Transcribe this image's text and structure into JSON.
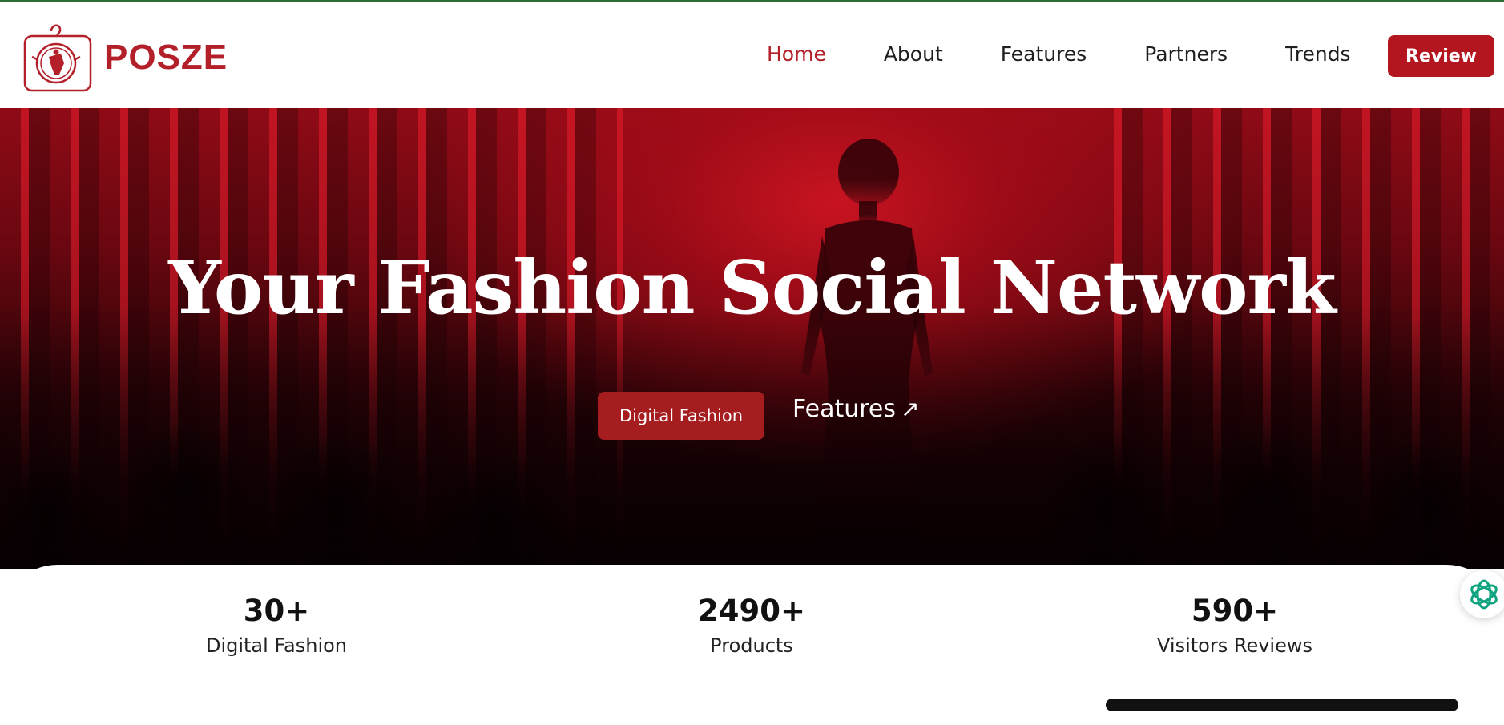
{
  "brand": {
    "name": "POSZE",
    "color": "#b3202a"
  },
  "nav": {
    "items": [
      {
        "label": "Home",
        "active": true
      },
      {
        "label": "About",
        "active": false
      },
      {
        "label": "Features",
        "active": false
      },
      {
        "label": "Partners",
        "active": false
      },
      {
        "label": "Trends",
        "active": false
      }
    ],
    "review_label": "Review"
  },
  "hero": {
    "title": "Your Fashion Social Network",
    "primary_cta": "Digital Fashion",
    "secondary_cta": "Features",
    "secondary_cta_icon": "arrow-up-right-icon"
  },
  "stats": [
    {
      "value": "30+",
      "label": "Digital Fashion"
    },
    {
      "value": "2490+",
      "label": "Products"
    },
    {
      "value": "590+",
      "label": "Visitors Reviews"
    }
  ],
  "colors": {
    "accent": "#b3161f",
    "hero_red": "#c8101f",
    "header_top_border": "#2f6b35",
    "assistant_icon": "#10a37f"
  }
}
